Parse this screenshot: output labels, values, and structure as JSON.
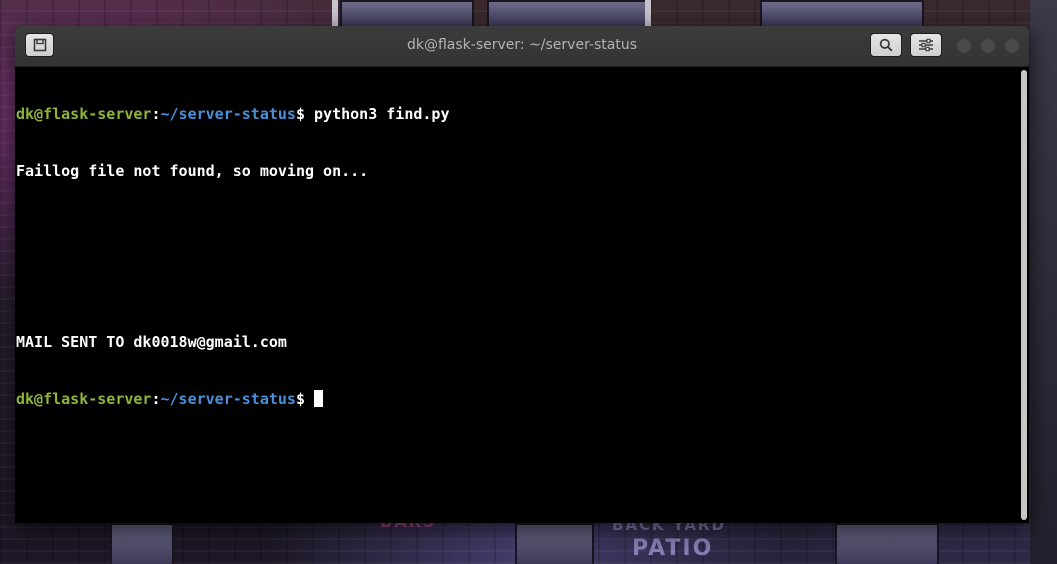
{
  "window": {
    "title": "dk@flask-server: ~/server-status"
  },
  "titlebar": {
    "left_button_icon": "new-tab-icon",
    "search_button_icon": "search-icon",
    "menu_button_icon": "hamburger-settings-icon",
    "window_controls": [
      "minimize",
      "maximize",
      "close"
    ]
  },
  "terminal": {
    "prompt_user": "dk@flask-server",
    "prompt_sep": ":",
    "prompt_path": "~/server-status",
    "prompt_symbol": "$ ",
    "command_1": "python3 find.py",
    "output_1": "Faillog file not found, so moving on...",
    "output_2": "",
    "output_3": "",
    "output_4": "MAIL SENT TO dk0018w@gmail.com"
  },
  "wallpaper": {
    "sign_left": "BARS",
    "sign_right": "BACK YARD",
    "sign_right_2": "PATIO"
  },
  "colors": {
    "prompt_user": "#8fb43a",
    "prompt_path": "#4a90d9",
    "terminal_bg": "#000000",
    "titlebar_bg": "#353535"
  }
}
